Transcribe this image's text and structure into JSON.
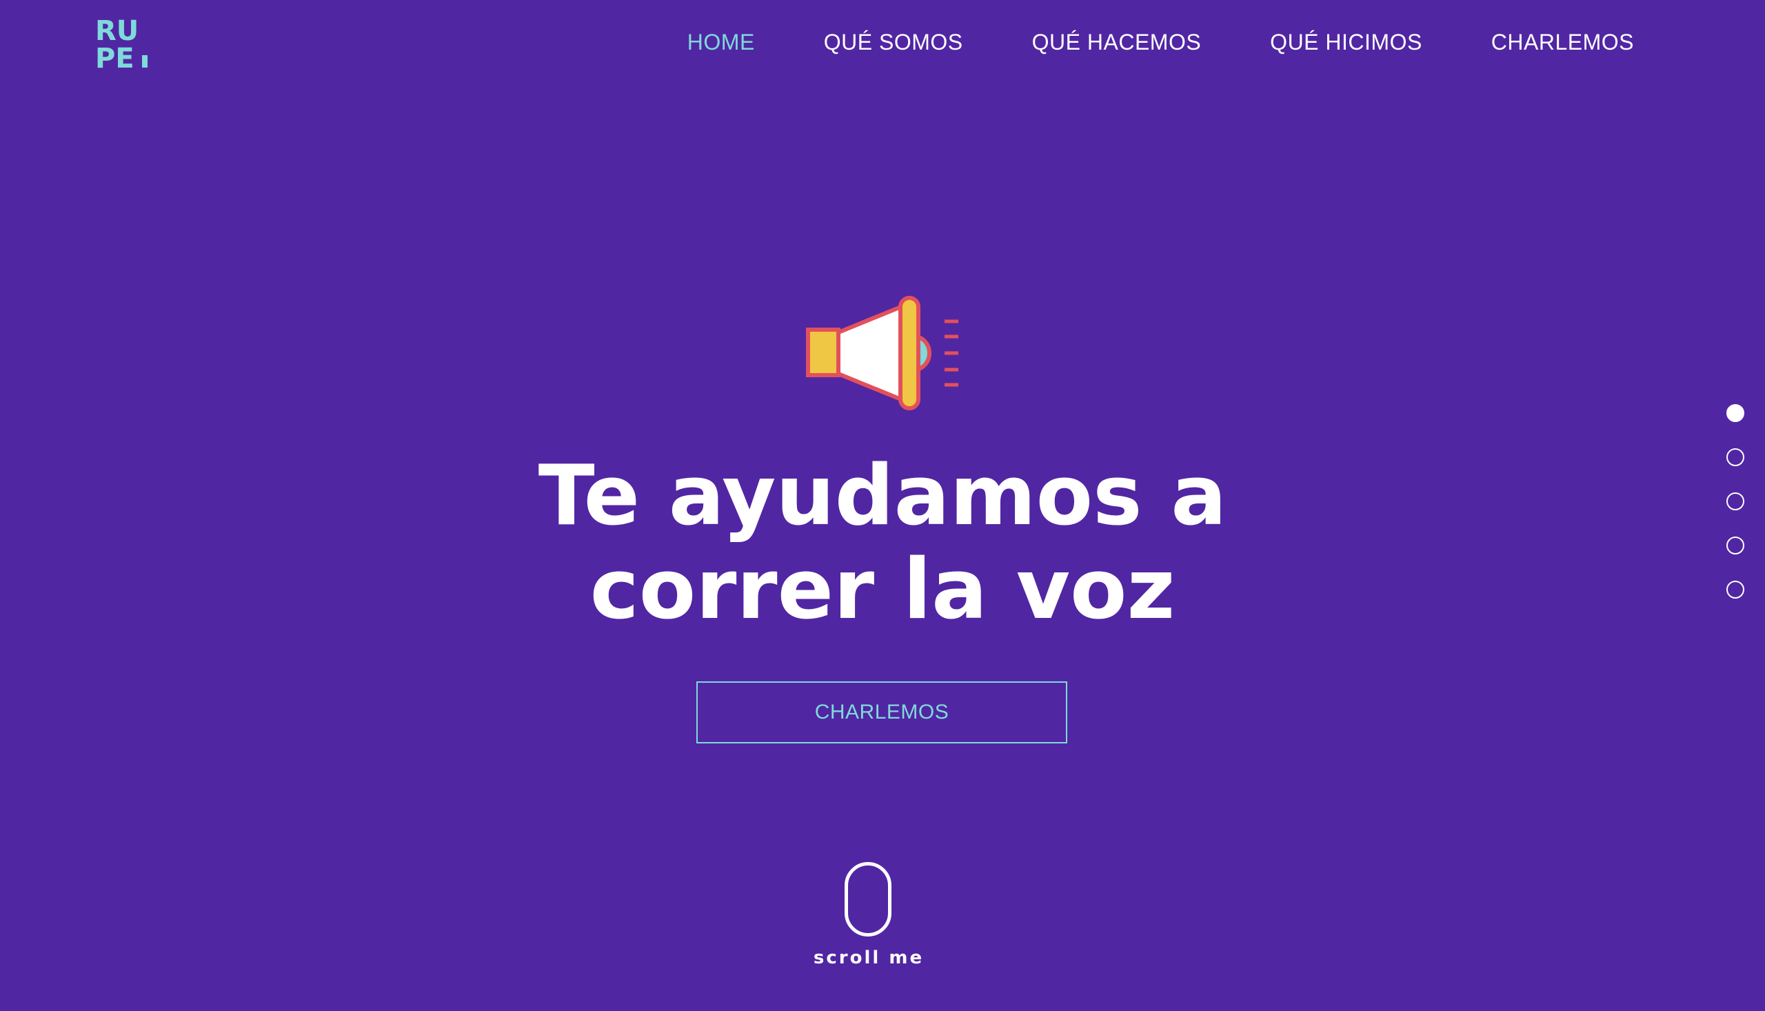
{
  "logo": {
    "top_text": "RU",
    "bottom_text": "PE",
    "color": "#7fdad9"
  },
  "nav": {
    "items": [
      {
        "label": "HOME",
        "active": true
      },
      {
        "label": "QUÉ SOMOS",
        "active": false
      },
      {
        "label": "QUÉ HACEMOS",
        "active": false
      },
      {
        "label": "QUÉ HICIMOS",
        "active": false
      },
      {
        "label": "CHARLEMOS",
        "active": false
      }
    ],
    "active_color": "#7fdad9"
  },
  "hero": {
    "icon": "megaphone-icon",
    "headline_line1": "Te ayudamos a",
    "headline_line2": "correr la voz",
    "cta_label": "CHARLEMOS"
  },
  "scroll": {
    "label": "scroll me"
  },
  "section_dots": {
    "count": 5,
    "active_index": 0
  },
  "colors": {
    "background": "#5126a3",
    "accent": "#7fdad9",
    "text": "#ffffff",
    "megaphone_yellow": "#f0c744",
    "megaphone_red": "#e2515b"
  }
}
